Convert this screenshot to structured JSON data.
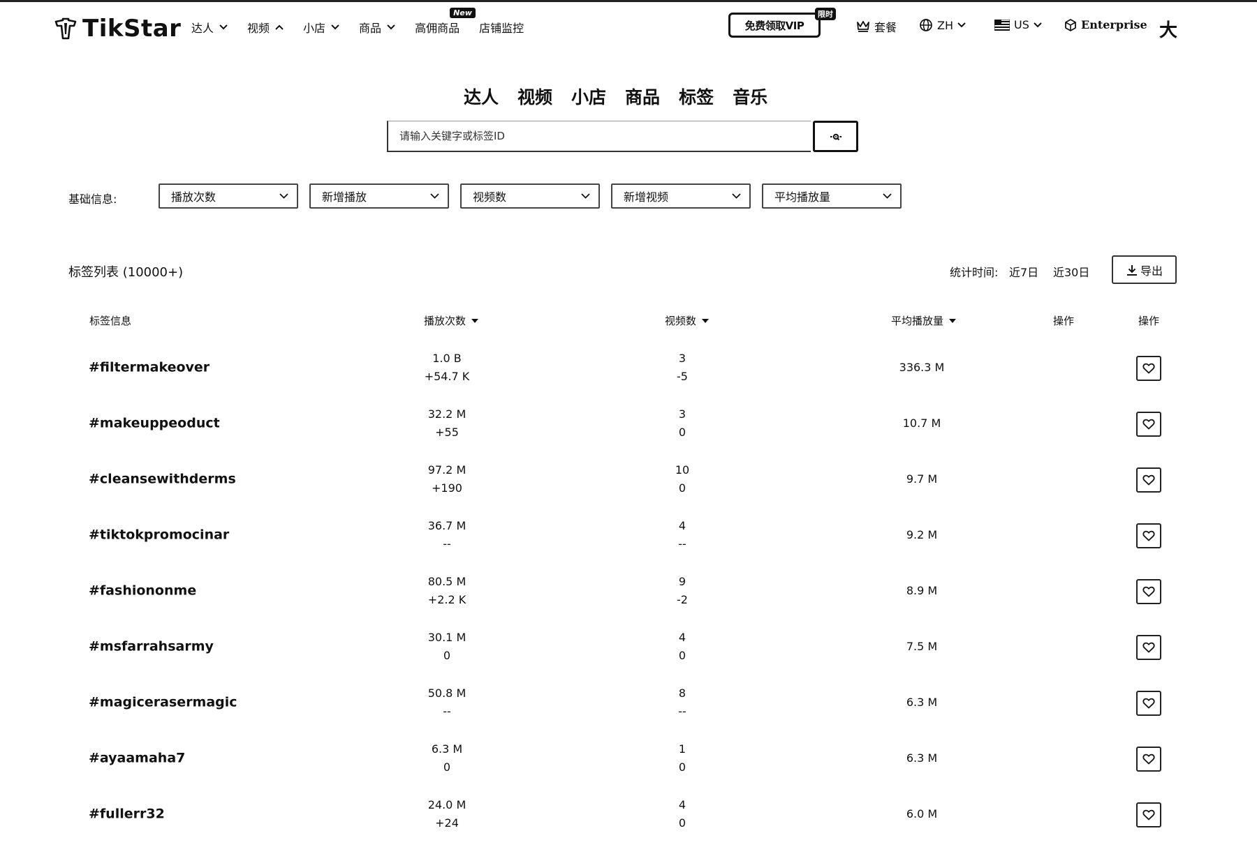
{
  "header": {
    "logo_text": "TikStar",
    "nav": [
      {
        "label": "达人",
        "chevron": "down"
      },
      {
        "label": "视频",
        "chevron": "up"
      },
      {
        "label": "小店",
        "chevron": "down"
      },
      {
        "label": "商品",
        "chevron": "down"
      },
      {
        "label": "高佣商品",
        "badge": "New"
      },
      {
        "label": "店铺监控"
      }
    ],
    "vip_button": "免费领取VIP",
    "vip_tag": "限时",
    "plans": "套餐",
    "language": "ZH",
    "region": "US",
    "enterprise": "Enterprise",
    "font_size_toggle": "大"
  },
  "category_tabs": [
    "达人",
    "视频",
    "小店",
    "商品",
    "标签",
    "音乐"
  ],
  "search": {
    "placeholder": "请输入关键字或标签ID",
    "value": ""
  },
  "filters": {
    "label": "基础信息:",
    "selects": [
      "播放次数",
      "新增播放",
      "视频数",
      "新增视频",
      "平均播放量"
    ]
  },
  "list": {
    "title": "标签列表 (10000+)",
    "stat_label": "统计时间:",
    "ranges": [
      "近7日",
      "近30日"
    ],
    "export": "导出"
  },
  "table": {
    "headers": {
      "tag": "标签信息",
      "plays": "播放次数",
      "videos": "视频数",
      "avg_plays": "平均播放量",
      "action1": "操作",
      "action2": "操作"
    },
    "rows": [
      {
        "tag": "#filtermakeover",
        "plays": "1.0 B",
        "plays_delta": "+54.7 K",
        "videos": "3",
        "videos_delta": "-5",
        "avg": "336.3 M"
      },
      {
        "tag": "#makeuppeoduct",
        "plays": "32.2 M",
        "plays_delta": "+55",
        "videos": "3",
        "videos_delta": "0",
        "avg": "10.7 M"
      },
      {
        "tag": "#cleansewithderms",
        "plays": "97.2 M",
        "plays_delta": "+190",
        "videos": "10",
        "videos_delta": "0",
        "avg": "9.7 M"
      },
      {
        "tag": "#tiktokpromocinar",
        "plays": "36.7 M",
        "plays_delta": "--",
        "videos": "4",
        "videos_delta": "--",
        "avg": "9.2 M"
      },
      {
        "tag": "#fashiononme",
        "plays": "80.5 M",
        "plays_delta": "+2.2 K",
        "videos": "9",
        "videos_delta": "-2",
        "avg": "8.9 M"
      },
      {
        "tag": "#msfarrahsarmy",
        "plays": "30.1 M",
        "plays_delta": "0",
        "videos": "4",
        "videos_delta": "0",
        "avg": "7.5 M"
      },
      {
        "tag": "#magicerasermagic",
        "plays": "50.8 M",
        "plays_delta": "--",
        "videos": "8",
        "videos_delta": "--",
        "avg": "6.3 M"
      },
      {
        "tag": "#ayaamaha7",
        "plays": "6.3 M",
        "plays_delta": "0",
        "videos": "1",
        "videos_delta": "0",
        "avg": "6.3 M"
      },
      {
        "tag": "#fullerr32",
        "plays": "24.0 M",
        "plays_delta": "+24",
        "videos": "4",
        "videos_delta": "0",
        "avg": "6.0 M"
      }
    ]
  }
}
